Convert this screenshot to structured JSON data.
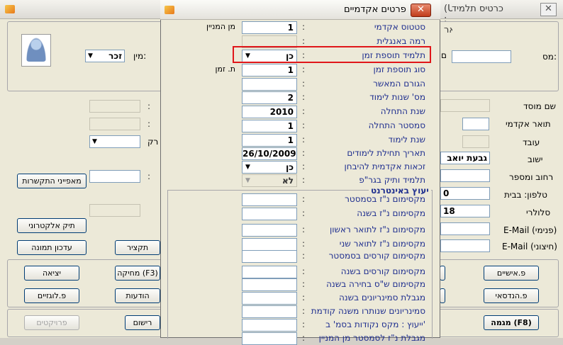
{
  "background_window": {
    "title": "כרטיס תלמיד",
    "title_extra": "(User : אר",
    "close_symbol": "✕",
    "labels": {
      "institution_name": "שם מוסד",
      "academic_degree": "תואר אקדמי",
      "worker": "עובד",
      "settlement": "ישוב",
      "street_number": "רחוב ומספר",
      "phone_home": "טלפון: בבית",
      "cellular": "סלולרי",
      "email_internal": "E-Mail (פנימי)",
      "email_external": "E-Mail (חיצוני)",
      "mispar": "מס:",
      "shem": "שם",
      "gender": "מין:",
      "prefix_rek": "רק",
      "bg_colon": ":"
    },
    "values": {
      "gender": "זכר",
      "settlement": "גבעת יואב",
      "phone_home_partial": "0",
      "cellular_partial": "18"
    },
    "buttons": {
      "communication_characteristics": "מאפייני התקשרות",
      "electronic_file": "תיק אלקטרוני",
      "update_image": "עדכון תמונה",
      "summary": "תקציר",
      "exit": "יציאה",
      "deletion": "מחיקה (F3)",
      "personal": "פ.אישיים",
      "schedules": "פ.לוגזיים",
      "messages": "הודעות",
      "engineering": "פ.הנדסאי",
      "projects": "פרויקטים",
      "registration": "רישום",
      "major": "מגמה (F8)"
    }
  },
  "dialog": {
    "title": "פרטים אקדמיים",
    "close_symbol": "✕",
    "rows": [
      {
        "label": "סטטוס אקדמי",
        "colon": ":",
        "value": "1",
        "extra": "מן המניין"
      },
      {
        "label": "רמה באנגלית",
        "colon": ":",
        "value": ""
      },
      {
        "label": "תלמיד תוספת זמן",
        "colon": ":",
        "value": "כן"
      },
      {
        "label": "סוג תוספת זמן",
        "colon": ":",
        "value": "1",
        "extra": "ת. זמן"
      },
      {
        "label": "הגורם המאשר",
        "colon": ":",
        "value": ""
      },
      {
        "label": "מס' שנות לימוד",
        "colon": ":",
        "value": "2"
      },
      {
        "label": "שנת התחלה",
        "colon": ":",
        "value": "2010"
      },
      {
        "label": "סמסטר התחלה",
        "colon": ":",
        "value": "1"
      },
      {
        "label": "שנת לימוד",
        "colon": ":",
        "value": "1"
      },
      {
        "label": "תאריך תחילת לימודים",
        "colon": ":",
        "value": "26/10/2009"
      },
      {
        "label": "זכאות אקדמית להיבחן",
        "colon": ":",
        "value": "כן"
      },
      {
        "label": "תלמיד ותיק בגר\"פ",
        "colon": ":",
        "value": "לא"
      }
    ],
    "internet_group_title": "יעוץ באינטרנט",
    "internet_rows": [
      {
        "label": "מקסימום נ\"ז בסמסטר",
        "colon": ":"
      },
      {
        "label": "מקסימום נ\"ז בשנה",
        "colon": ":"
      },
      {
        "label": "מקסימום נ\"ז לתואר ראשון",
        "colon": ":"
      },
      {
        "label": "מקסימום נ\"ז לתואר שני",
        "colon": ":"
      },
      {
        "label": "מקסימום קורסים בסמסטר",
        "colon": ":"
      },
      {
        "label": "מקסימום קורסים בשנה",
        "colon": ":"
      },
      {
        "label": "מקסימום ש\"ס בחירה בשנה",
        "colon": ":"
      },
      {
        "label": "מגבלת סמינריונים בשנה",
        "colon": ":"
      },
      {
        "label": "סמינריונים שנותרו משנה קודמת",
        "colon": ":"
      },
      {
        "label": "ייעוץ : מקס נקודות בסמ' ב'",
        "colon": ":"
      },
      {
        "label": "מגבלת נ\"ז לסמסטר מן המניין",
        "colon": ":"
      }
    ]
  }
}
